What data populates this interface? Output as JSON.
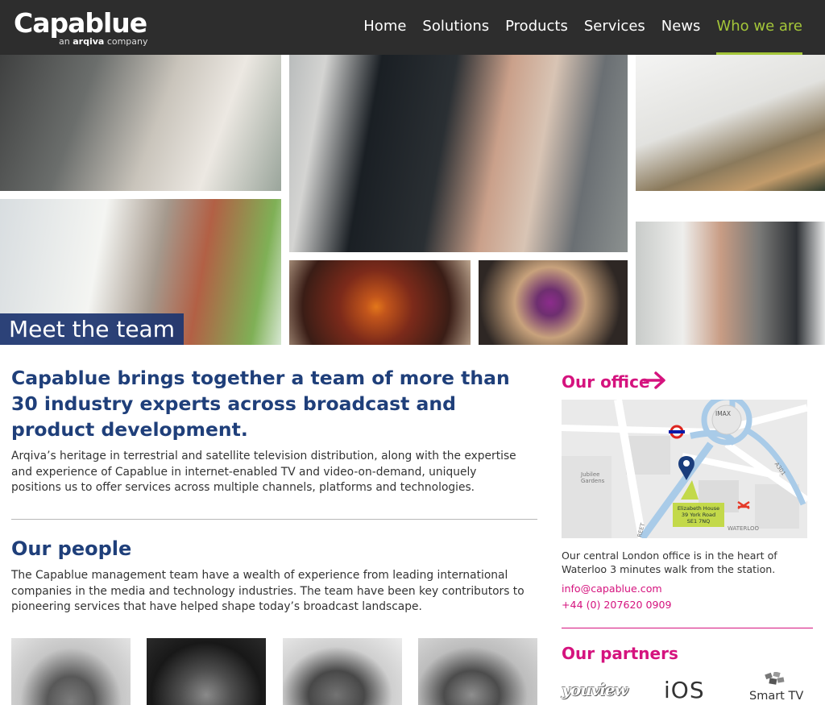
{
  "brand": {
    "name": "Capablue",
    "tagline_prefix": "an",
    "tagline_brand": "arqiva",
    "tagline_suffix": "company"
  },
  "nav": {
    "items": [
      "Home",
      "Solutions",
      "Products",
      "Services",
      "News",
      "Who we are"
    ],
    "active": "Who we are"
  },
  "hero": {
    "caption": "Meet the team"
  },
  "intro": {
    "heading": "Capablue brings together a team of more than 30 industry experts across broadcast and product development.",
    "body": "Arqiva’s heritage in terrestrial and satellite television distribution, along with the expertise and experience of Capablue in internet-enabled TV and video-on-demand, uniquely positions us to offer services across multiple channels, platforms and technologies."
  },
  "people": {
    "heading": "Our people",
    "body": "The Capablue management team have a wealth of experience from leading international companies in the media and technology industries. The team have been key contributors to pioneering services that have helped shape today’s broadcast landscape."
  },
  "office": {
    "heading": "Our office",
    "map": {
      "address_line1": "Elizabeth House",
      "address_line2": "39 York Road",
      "address_line3": "SE1 7NQ",
      "label_imax": "IMAX",
      "label_waterloo": "WATERLOO",
      "label_jubilee_line1": "Jubilee",
      "label_jubilee_line2": "Gardens",
      "label_a301": "A301",
      "label_street": "REET"
    },
    "description": "Our central London office is in the heart of Waterloo 3 minutes walk from the station.",
    "email": "info@capablue.com",
    "phone": "+44 (0) 207620 0909"
  },
  "partners": {
    "heading": "Our partners",
    "youview": "youview",
    "ios": "iOS",
    "smarttv": "Smart TV"
  },
  "colors": {
    "header_bg": "#2d2d2d",
    "nav_active": "#a4c639",
    "heading_blue": "#1f3f7a",
    "accent_pink": "#d5137e",
    "caption_bg": "#1e3670"
  }
}
